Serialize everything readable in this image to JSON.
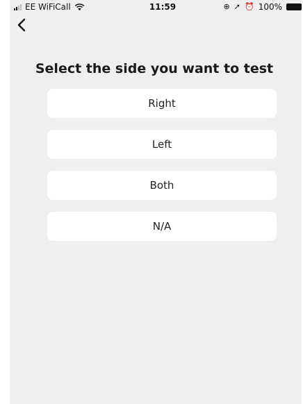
{
  "status_bar": {
    "carrier": "EE WiFiCall",
    "time": "11:59",
    "battery": "100%"
  },
  "icons": {
    "back": "chevron-left-icon",
    "wifi": "wifi-icon",
    "signal": "signal-icon",
    "location": "location-arrow-icon",
    "alarm": "alarm-icon",
    "lock_rotation": "orientation-lock-icon",
    "battery": "battery-icon"
  },
  "page": {
    "title": "Select the side you want to test"
  },
  "options": [
    {
      "label": "Right"
    },
    {
      "label": "Left"
    },
    {
      "label": "Both"
    },
    {
      "label": "N/A"
    }
  ]
}
